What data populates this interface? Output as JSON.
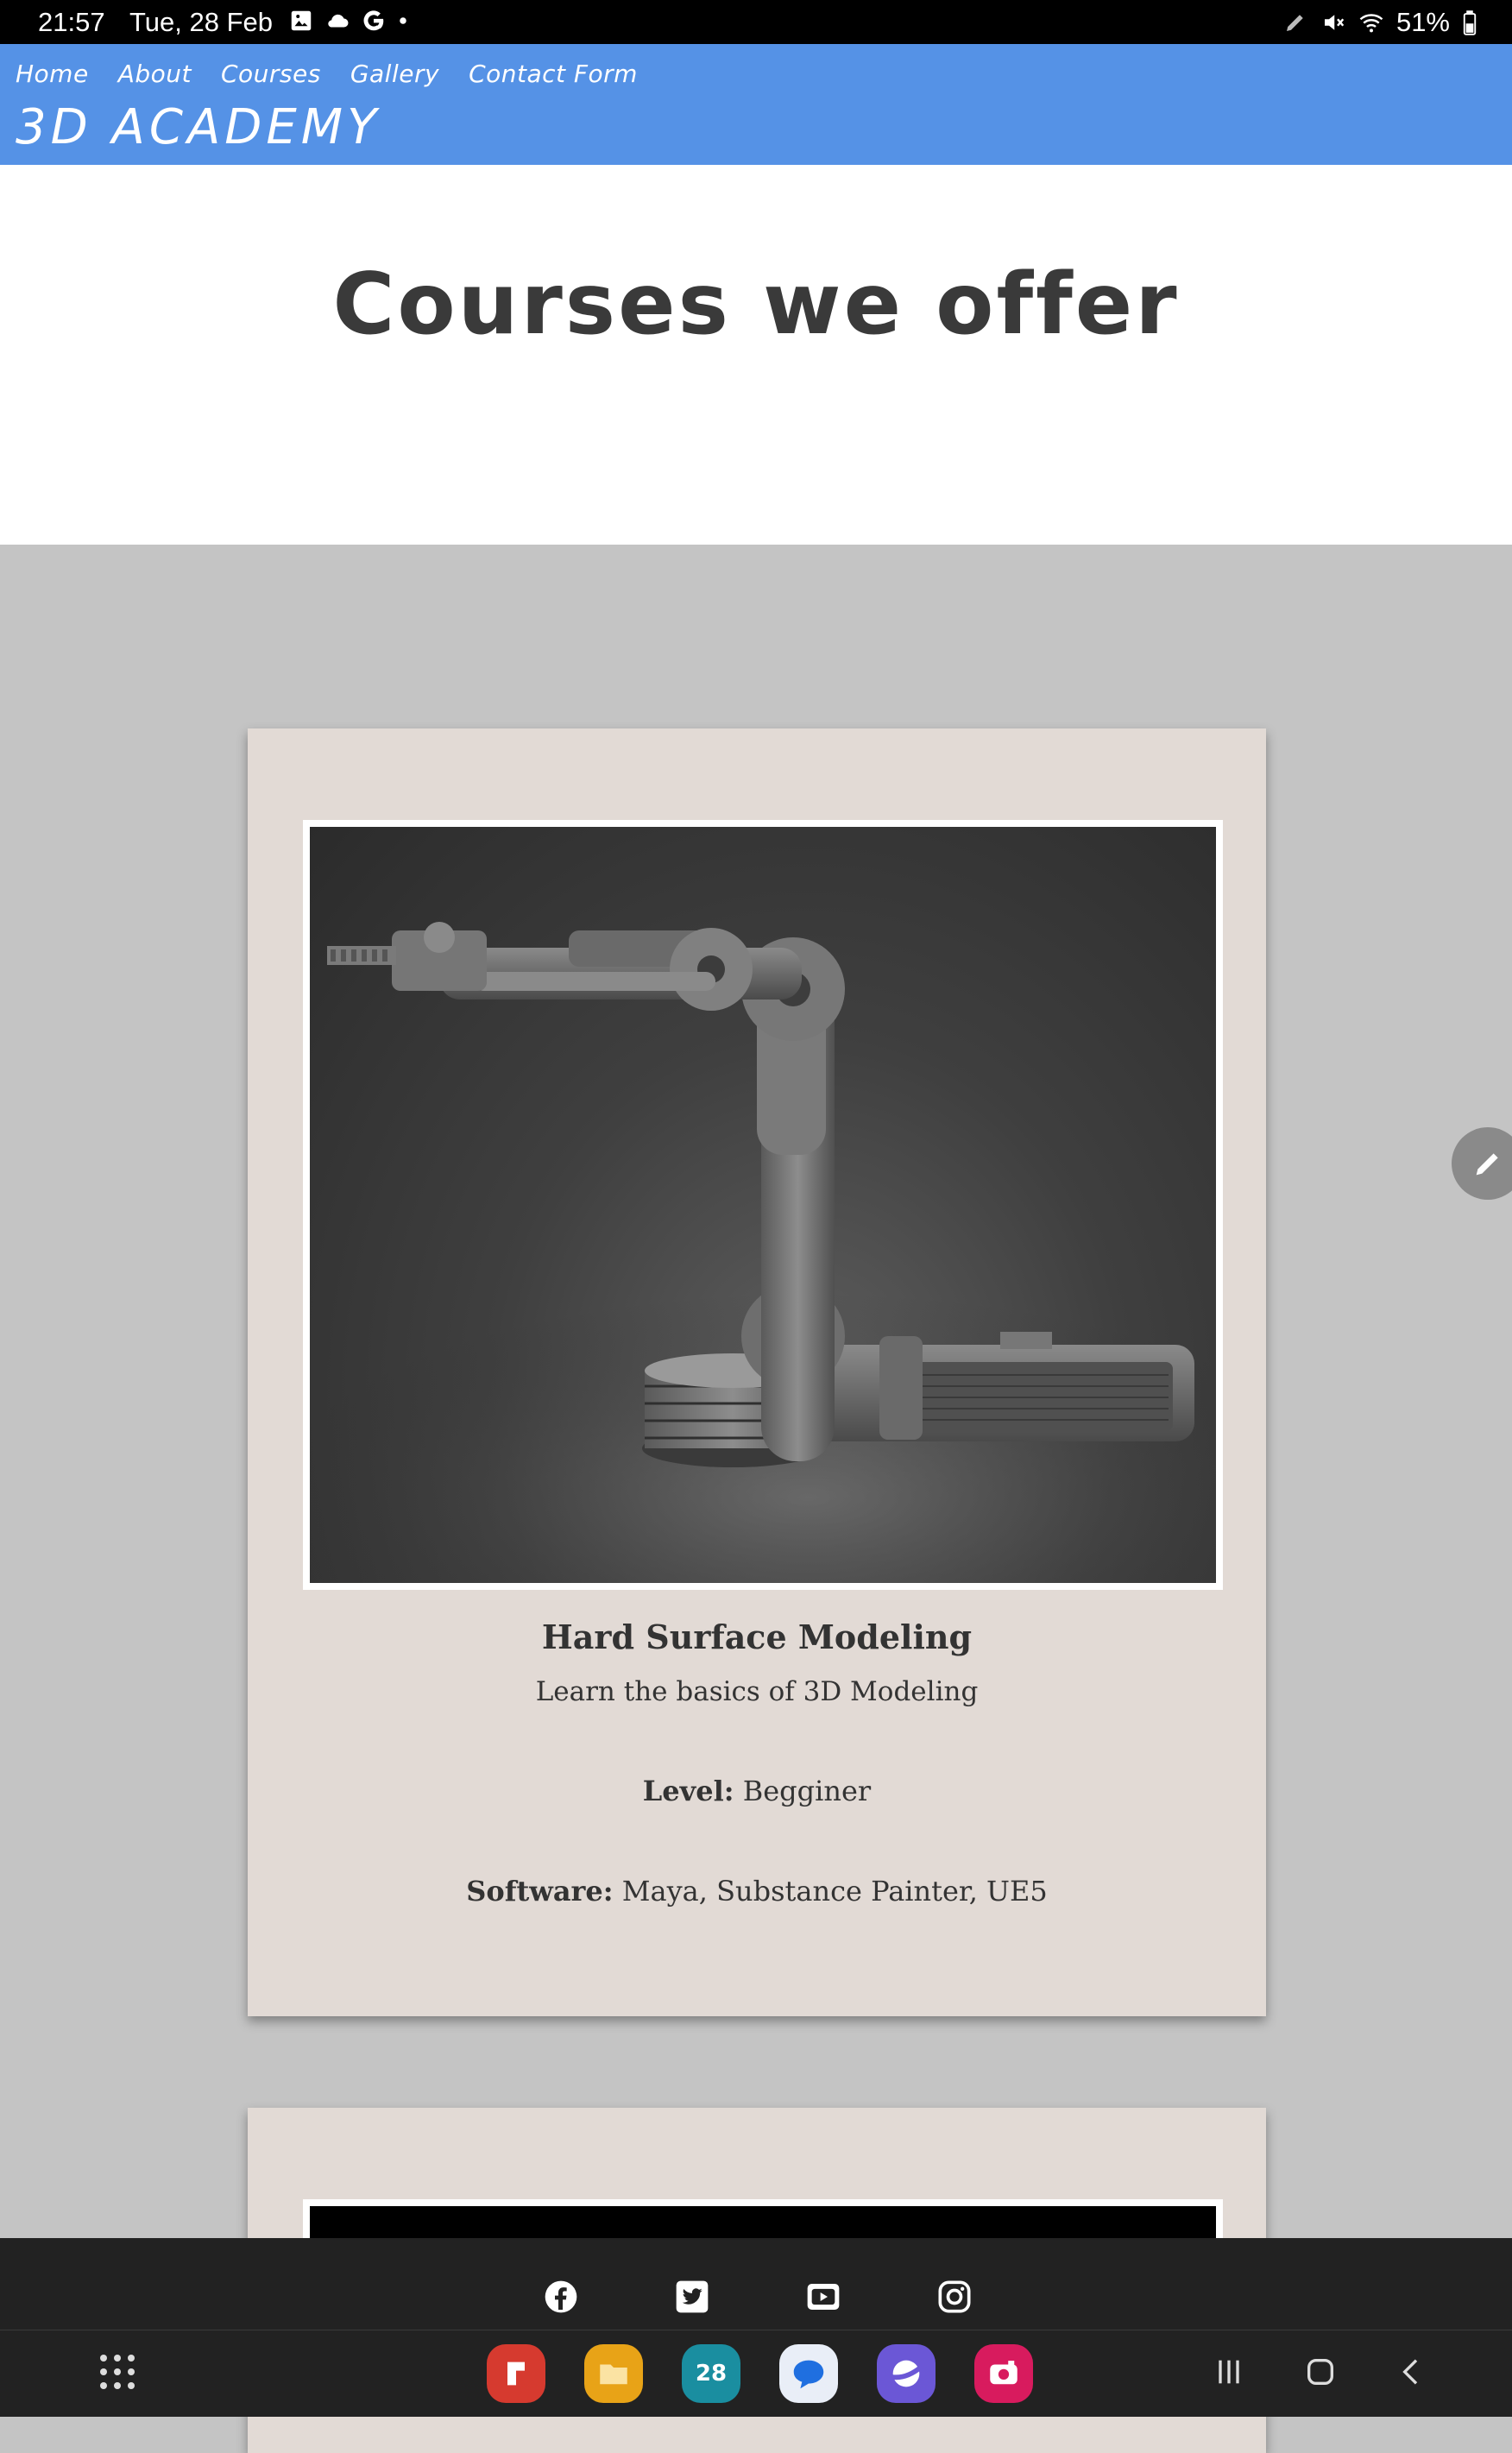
{
  "status_bar": {
    "time": "21:57",
    "date": "Tue, 28 Feb",
    "battery": "51%",
    "left_icons": [
      "gallery-icon",
      "cloud-icon",
      "google-icon",
      "dot-icon"
    ],
    "right_icons": [
      "pen-icon",
      "mute-icon",
      "wifi-icon",
      "battery-icon"
    ]
  },
  "nav": {
    "items": [
      "Home",
      "About",
      "Courses",
      "Gallery",
      "Contact Form"
    ],
    "brand": "3D ACADEMY"
  },
  "hero": {
    "title": "Courses we offer"
  },
  "courses": [
    {
      "title": "Hard Surface Modeling",
      "subtitle": "Learn the basics of 3D Modeling",
      "level_label": "Level:",
      "level": "Begginer",
      "software_label": "Software:",
      "software": "Maya, Substance Painter, UE5",
      "image": "robotic-arm-render"
    }
  ],
  "footer": {
    "social_icons": [
      "facebook-icon",
      "twitter-icon",
      "youtube-icon",
      "instagram-icon"
    ]
  },
  "android_bar": {
    "dock_apps": [
      {
        "name": "flipboard-app-icon",
        "color": "#d63a2f"
      },
      {
        "name": "files-app-icon",
        "color": "#e8a317"
      },
      {
        "name": "calendar-app-icon",
        "color": "#1a8ea0",
        "label": "28"
      },
      {
        "name": "messages-app-icon",
        "color": "#e9eef7"
      },
      {
        "name": "internet-app-icon",
        "color": "#6b57d6"
      },
      {
        "name": "camera-app-icon",
        "color": "#d81b5e"
      }
    ],
    "system_buttons": [
      "recents-button",
      "home-button",
      "back-button"
    ]
  },
  "colors": {
    "header": "#5592e6",
    "page_bg": "#c4c4c4",
    "card_bg": "#e2dad5",
    "footer_bg": "#222222"
  }
}
